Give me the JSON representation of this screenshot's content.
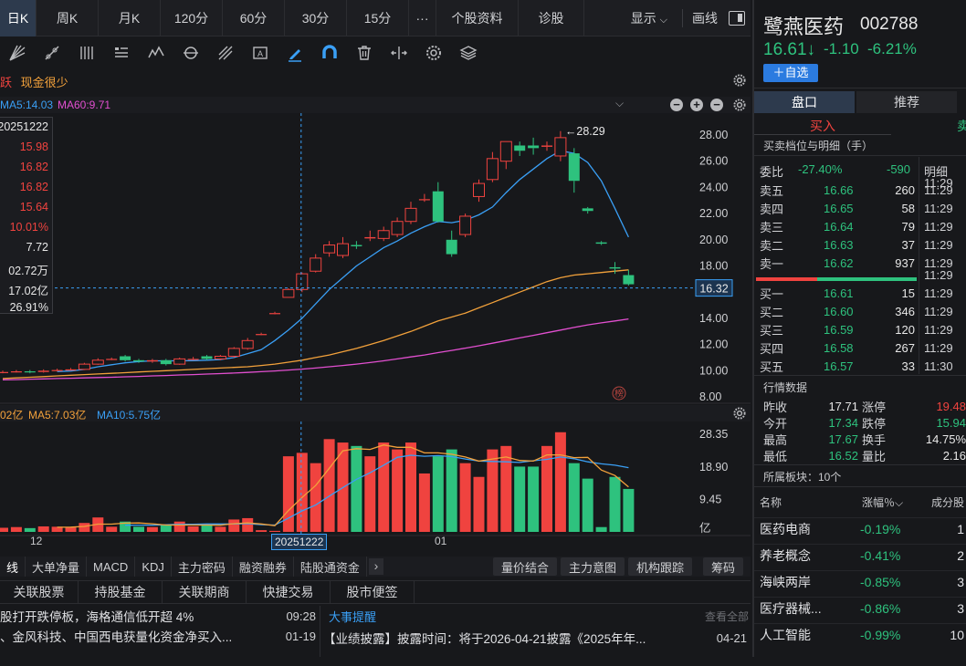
{
  "tabs": [
    {
      "label": "日K",
      "active": true
    },
    {
      "label": "周K"
    },
    {
      "label": "月K"
    },
    {
      "label": "120分"
    },
    {
      "label": "60分"
    },
    {
      "label": "30分"
    },
    {
      "label": "15分"
    },
    {
      "label": "···"
    },
    {
      "label": "个股资料"
    },
    {
      "label": "诊股"
    }
  ],
  "tabbar_right": {
    "display": "显示",
    "display_arrow": "⌵",
    "draw": "画线"
  },
  "alerts": {
    "a1": "跃",
    "a2": "现金很少"
  },
  "ma_legend": {
    "ma5": "MA5:14.03",
    "ma60": "MA60:9.71"
  },
  "tooltip": {
    "date": "20251222",
    "values": [
      "15.98",
      "16.82",
      "16.82",
      "15.64",
      "10.01%",
      "7.72",
      "02.72万",
      "17.02亿",
      "26.91%"
    ]
  },
  "price_axis": [
    "28.00",
    "26.00",
    "24.00",
    "22.00",
    "20.00",
    "18.00",
    "16.00",
    "14.00",
    "12.00",
    "10.00",
    "8.00"
  ],
  "current_price_tag": "16.32",
  "high_marker": "←28.29",
  "rank_badge": "榜",
  "vol_legend": {
    "v0": "02亿",
    "ma5": "MA5:7.03亿",
    "ma10": "MA10:5.75亿"
  },
  "vol_axis": [
    "28.35",
    "18.90",
    "9.45",
    "亿"
  ],
  "date_axis": {
    "d1": "12",
    "cursor": "20251222",
    "d2": "01"
  },
  "ind_tabs": [
    "线",
    "大单净量",
    "MACD",
    "KDJ",
    "主力密码",
    "融资融券",
    "陆股通资金"
  ],
  "ind_more": "›",
  "ind_btns": [
    "量价结合",
    "主力意图",
    "机构跟踪"
  ],
  "ind_right": "筹码",
  "low_tabs": [
    "关联股票",
    "持股基金",
    "关联期商",
    "快捷交易",
    "股市便签"
  ],
  "news_left": [
    {
      "text": "股打开跌停板，海格通信低开超 4%",
      "time": "09:28"
    },
    {
      "text": "、金风科技、中国西电获量化资金净买入...",
      "time": "01-19"
    },
    {
      "text": "",
      "time": ""
    }
  ],
  "news_right_title": "大事提醒",
  "news_right_more": "查看全部",
  "news_right": [
    {
      "text": "【业绩披露】披露时间：将于2026-04-21披露《2025年年...",
      "time": "04-21"
    }
  ],
  "stock": {
    "name": "鹭燕医药",
    "code": "002788",
    "price": "16.61↓",
    "change": "-1.10",
    "pct": "-6.21%",
    "add_btn": "＋自选"
  },
  "rtabs": [
    "盘口",
    "推荐"
  ],
  "buy_label": "买入",
  "sell_label": "卖",
  "book_title": "买卖档位与明细（手）",
  "weibi": {
    "label": "委比",
    "pct": "-27.40%",
    "diff": "-590",
    "detail": "明细"
  },
  "sells": [
    {
      "l": "卖五",
      "p": "16.66",
      "v": "260",
      "t": "11:29"
    },
    {
      "l": "卖四",
      "p": "16.65",
      "v": "58",
      "t": "11:29"
    },
    {
      "l": "卖三",
      "p": "16.64",
      "v": "79",
      "t": "11:29"
    },
    {
      "l": "卖二",
      "p": "16.63",
      "v": "37",
      "t": "11:29"
    },
    {
      "l": "卖一",
      "p": "16.62",
      "v": "937",
      "t": "11:29"
    }
  ],
  "buys": [
    {
      "l": "买一",
      "p": "16.61",
      "v": "15",
      "t": "11:29"
    },
    {
      "l": "买二",
      "p": "16.60",
      "v": "346",
      "t": "11:29"
    },
    {
      "l": "买三",
      "p": "16.59",
      "v": "120",
      "t": "11:29"
    },
    {
      "l": "买四",
      "p": "16.58",
      "v": "267",
      "t": "11:29"
    },
    {
      "l": "买五",
      "p": "16.57",
      "v": "33",
      "t": "11:30"
    }
  ],
  "detail_top": "11:29",
  "quote_title": "行情数据",
  "quotes": [
    {
      "a": "昨收",
      "av": "17.71",
      "b": "涨停",
      "bv": "19.48"
    },
    {
      "a": "今开",
      "av": "17.34",
      "b": "跌停",
      "bv": "15.94"
    },
    {
      "a": "最高",
      "av": "17.67",
      "b": "换手",
      "bv": "14.75%"
    },
    {
      "a": "最低",
      "av": "16.52",
      "b": "量比",
      "bv": "2.16"
    }
  ],
  "sector_title": "所属板块：10个",
  "sector_head": {
    "name": "名称",
    "pct": "涨幅％⌵",
    "comp": "成分股"
  },
  "sectors": [
    {
      "n": "医药电商",
      "p": "-0.19%",
      "c": "1"
    },
    {
      "n": "养老概念",
      "p": "-0.41%",
      "c": "2"
    },
    {
      "n": "海峡两岸",
      "p": "-0.85%",
      "c": "3"
    },
    {
      "n": "医疗器械...",
      "p": "-0.86%",
      "c": "3"
    },
    {
      "n": "人工智能",
      "p": "-0.99%",
      "c": "10"
    }
  ],
  "colors": {
    "up": "#f0433f",
    "down": "#2ec27e",
    "ma5": "#3a9ff5",
    "ma60": "#e24fd0",
    "ma20": "#f2a13b"
  },
  "chart_data": {
    "type": "candlestick",
    "y_range": [
      8,
      28
    ],
    "candles": [
      [
        9.85,
        9.9,
        9.8,
        10.0
      ],
      [
        9.9,
        9.95,
        9.85,
        10.05
      ],
      [
        9.95,
        9.9,
        9.8,
        10.05
      ],
      [
        9.9,
        10.0,
        9.85,
        10.1
      ],
      [
        10.0,
        10.05,
        9.95,
        10.15
      ],
      [
        10.05,
        10.1,
        10.0,
        10.2
      ],
      [
        10.1,
        10.5,
        10.05,
        10.6
      ],
      [
        10.5,
        10.8,
        10.45,
        10.95
      ],
      [
        10.9,
        10.9,
        10.8,
        11.0
      ],
      [
        11.1,
        10.8,
        10.7,
        11.2
      ],
      [
        10.8,
        10.7,
        10.6,
        10.9
      ],
      [
        10.7,
        10.8,
        10.6,
        10.9
      ],
      [
        10.8,
        10.5,
        10.4,
        10.9
      ],
      [
        10.5,
        10.9,
        10.45,
        11.0
      ],
      [
        10.9,
        10.9,
        10.8,
        11.05
      ],
      [
        11.1,
        10.9,
        10.8,
        11.2
      ],
      [
        10.9,
        11.1,
        10.8,
        11.2
      ],
      [
        11.1,
        11.7,
        11.0,
        11.8
      ],
      [
        11.7,
        12.3,
        11.6,
        12.5
      ],
      [
        12.8,
        12.8,
        12.7,
        12.9
      ],
      [
        14.4,
        14.4,
        14.3,
        14.5
      ],
      [
        15.6,
        16.2,
        15.6,
        16.3
      ],
      [
        16.2,
        17.4,
        16.0,
        17.5
      ],
      [
        17.6,
        18.6,
        17.5,
        18.9
      ],
      [
        19.0,
        19.6,
        18.7,
        19.9
      ],
      [
        18.8,
        19.7,
        18.6,
        20.2
      ],
      [
        19.6,
        19.5,
        19.3,
        19.9
      ],
      [
        20.1,
        20.2,
        19.9,
        20.7
      ],
      [
        20.1,
        20.7,
        19.9,
        21.0
      ],
      [
        20.4,
        21.4,
        20.2,
        21.7
      ],
      [
        21.4,
        22.4,
        21.2,
        22.9
      ],
      [
        23.1,
        23.1,
        22.9,
        23.5
      ],
      [
        23.7,
        21.4,
        21.3,
        24.4
      ],
      [
        20.0,
        18.9,
        18.7,
        20.7
      ],
      [
        20.4,
        21.8,
        20.2,
        22.0
      ],
      [
        23.3,
        24.3,
        22.9,
        24.6
      ],
      [
        24.6,
        26.2,
        24.4,
        26.7
      ],
      [
        26.0,
        27.5,
        25.4,
        27.5
      ],
      [
        27.2,
        26.8,
        26.4,
        27.5
      ],
      [
        27.2,
        27.0,
        26.5,
        27.8
      ],
      [
        27.1,
        27.2,
        26.8,
        27.5
      ],
      [
        26.4,
        27.8,
        26.0,
        28.3
      ],
      [
        26.6,
        24.5,
        23.6,
        27.0
      ],
      [
        22.4,
        22.2,
        22.0,
        22.5
      ],
      [
        19.8,
        19.7,
        19.6,
        19.9
      ],
      [
        17.9,
        17.8,
        17.4,
        18.3
      ],
      [
        17.3,
        16.6,
        16.5,
        17.7
      ]
    ],
    "ma5": [
      null,
      null,
      null,
      null,
      9.94,
      9.97,
      10.1,
      10.3,
      10.45,
      10.6,
      10.7,
      10.75,
      10.75,
      10.75,
      10.77,
      10.8,
      10.85,
      11.0,
      11.3,
      11.6,
      12.3,
      13.1,
      14.0,
      15.1,
      16.2,
      17.1,
      18.0,
      18.7,
      19.4,
      19.9,
      20.5,
      21.0,
      21.4,
      21.3,
      21.5,
      21.9,
      22.5,
      23.6,
      24.6,
      25.4,
      26.2,
      26.8,
      26.6,
      25.9,
      24.5,
      22.4,
      20.2
    ],
    "ma20": [
      9.4,
      9.45,
      9.5,
      9.55,
      9.6,
      9.65,
      9.7,
      9.75,
      9.8,
      9.85,
      9.9,
      9.95,
      10.0,
      10.05,
      10.1,
      10.15,
      10.2,
      10.25,
      10.3,
      10.4,
      10.5,
      10.65,
      10.8,
      11.0,
      11.2,
      11.45,
      11.7,
      12.0,
      12.3,
      12.65,
      13.0,
      13.4,
      13.8,
      14.1,
      14.4,
      14.8,
      15.2,
      15.6,
      16.0,
      16.4,
      16.8,
      17.1,
      17.3,
      17.4,
      17.5,
      17.6,
      17.7
    ],
    "ma60": [
      9.3,
      9.32,
      9.35,
      9.37,
      9.4,
      9.42,
      9.45,
      9.48,
      9.5,
      9.53,
      9.56,
      9.6,
      9.63,
      9.67,
      9.7,
      9.74,
      9.78,
      9.82,
      9.87,
      9.92,
      9.98,
      10.05,
      10.12,
      10.2,
      10.3,
      10.4,
      10.5,
      10.62,
      10.75,
      10.9,
      11.05,
      11.2,
      11.38,
      11.55,
      11.72,
      11.9,
      12.1,
      12.3,
      12.5,
      12.7,
      12.9,
      13.1,
      13.3,
      13.5,
      13.65,
      13.8,
      13.95
    ],
    "volume": [
      1.2,
      1.4,
      1.1,
      1.6,
      1.5,
      1.3,
      2.6,
      4.2,
      1.5,
      3.0,
      1.5,
      1.4,
      2.0,
      3.0,
      1.6,
      2.3,
      1.5,
      3.6,
      4.0,
      0.5,
      0.3,
      22.0,
      23.0,
      20.0,
      27.0,
      26.0,
      25.0,
      22.0,
      26.0,
      24.0,
      26.0,
      17.0,
      22.0,
      24.0,
      20.0,
      16.0,
      24.0,
      25.0,
      19.0,
      19.0,
      25.0,
      29.0,
      20.0,
      15.5,
      1.4,
      16.0,
      12.5
    ],
    "vol_ma5": [
      null,
      null,
      null,
      null,
      1.36,
      1.38,
      1.6,
      2.25,
      2.25,
      2.55,
      2.6,
      2.35,
      2.0,
      2.0,
      2.0,
      2.0,
      1.95,
      2.4,
      2.6,
      2.3,
      1.8,
      6.2,
      10.0,
      13.5,
      18.5,
      23.6,
      24.2,
      24.0,
      25.3,
      24.6,
      24.6,
      23.0,
      23.0,
      22.6,
      21.8,
      20.6,
      21.2,
      21.8,
      20.8,
      20.6,
      22.4,
      22.4,
      21.6,
      21.7,
      18.0,
      16.4,
      13.1
    ],
    "vol_ma10": [
      null,
      null,
      null,
      null,
      null,
      null,
      null,
      null,
      null,
      1.94,
      1.97,
      1.97,
      2.06,
      2.2,
      2.2,
      2.3,
      2.3,
      2.3,
      2.4,
      2.1,
      2.0,
      4.0,
      6.1,
      7.8,
      10.4,
      12.9,
      15.3,
      17.2,
      19.4,
      21.7,
      22.3,
      22.0,
      22.2,
      21.9,
      21.2,
      20.6,
      20.5,
      20.4,
      20.2,
      20.7,
      21.1,
      21.8,
      21.3,
      20.4,
      19.8,
      19.4,
      18.7
    ],
    "vol_range": [
      0,
      30
    ]
  }
}
